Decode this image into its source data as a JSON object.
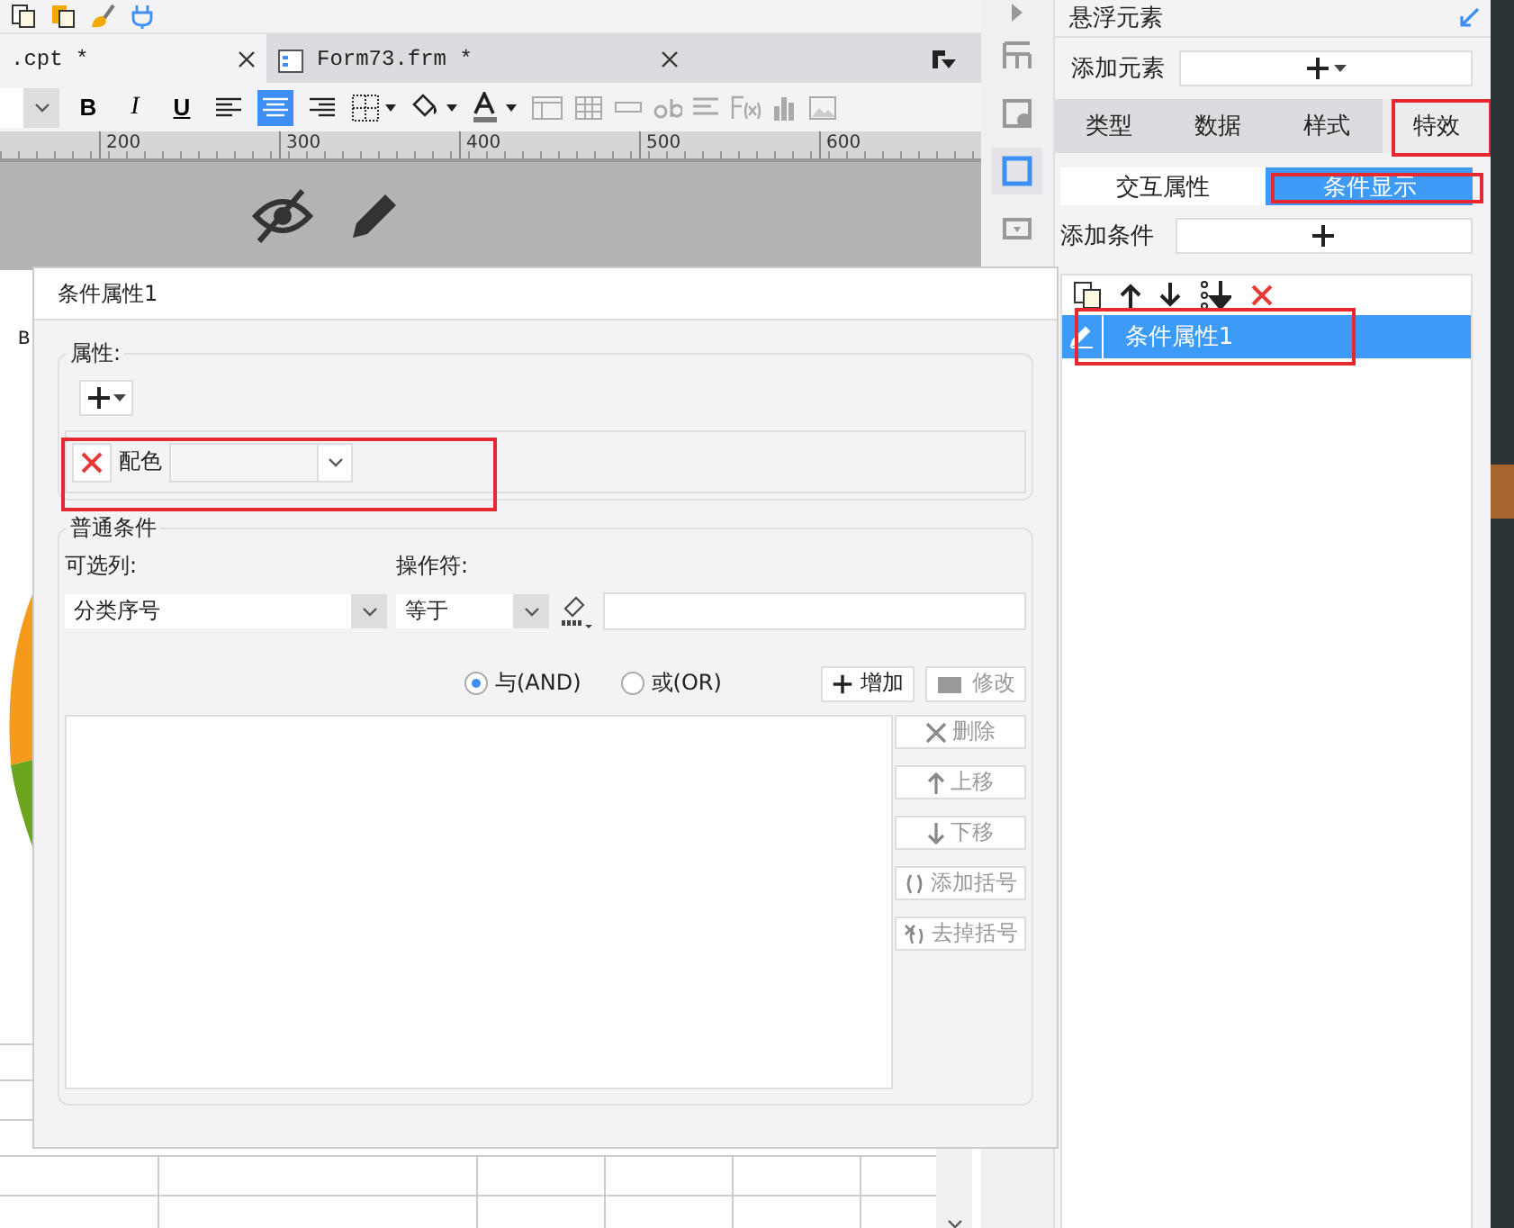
{
  "editor_tabs": [
    {
      "label": ".cpt *",
      "selected": true
    },
    {
      "label": "Form73.frm *",
      "selected": false
    }
  ],
  "format_toolbar": {
    "style_buttons": [
      "B",
      "I",
      "U"
    ],
    "alignment": [
      {
        "selected": false
      },
      {
        "selected": true
      },
      {
        "selected": false
      }
    ]
  },
  "ruler": {
    "labels": [
      "200",
      "300",
      "400",
      "500",
      "600"
    ]
  },
  "canvas": {
    "cell_text": "B"
  },
  "tool_strip": [
    {
      "selected": false
    },
    {
      "selected": false
    },
    {
      "selected": true
    },
    {
      "selected": false
    }
  ],
  "side_panel": {
    "title": "悬浮元素",
    "add_element_label": "添加元素",
    "tabs": [
      {
        "label": "类型",
        "selected": false
      },
      {
        "label": "数据",
        "selected": false
      },
      {
        "label": "样式",
        "selected": false
      },
      {
        "label": "特效",
        "selected": true
      }
    ],
    "sub_tabs": [
      {
        "label": "交互属性",
        "selected": false
      },
      {
        "label": "条件显示",
        "selected": true
      }
    ],
    "add_condition_label": "添加条件",
    "conditions": [
      {
        "label": "条件属性1",
        "selected": true
      }
    ]
  },
  "dialog": {
    "title": "条件属性1",
    "properties": {
      "legend": "属性:",
      "items": [
        {
          "label": "配色"
        }
      ]
    },
    "conditions": {
      "legend": "普通条件",
      "column_label": "可选列:",
      "column_value": "分类序号",
      "operator_label": "操作符:",
      "operator_value": "等于",
      "logic": [
        {
          "label": "与(AND)",
          "selected": true
        },
        {
          "label": "或(OR)",
          "selected": false
        }
      ],
      "add_button": {
        "label": "增加",
        "disabled": false
      },
      "edit_button": {
        "label": "修改",
        "disabled": true
      },
      "side_buttons": [
        {
          "kind": "delete",
          "label": "删除",
          "disabled": true
        },
        {
          "kind": "up",
          "label": "上移",
          "disabled": true
        },
        {
          "kind": "down",
          "label": "下移",
          "disabled": true
        },
        {
          "kind": "add-paren",
          "label": "添加括号",
          "disabled": true
        },
        {
          "kind": "remove-paren",
          "label": "去掉括号",
          "disabled": true
        }
      ]
    }
  }
}
